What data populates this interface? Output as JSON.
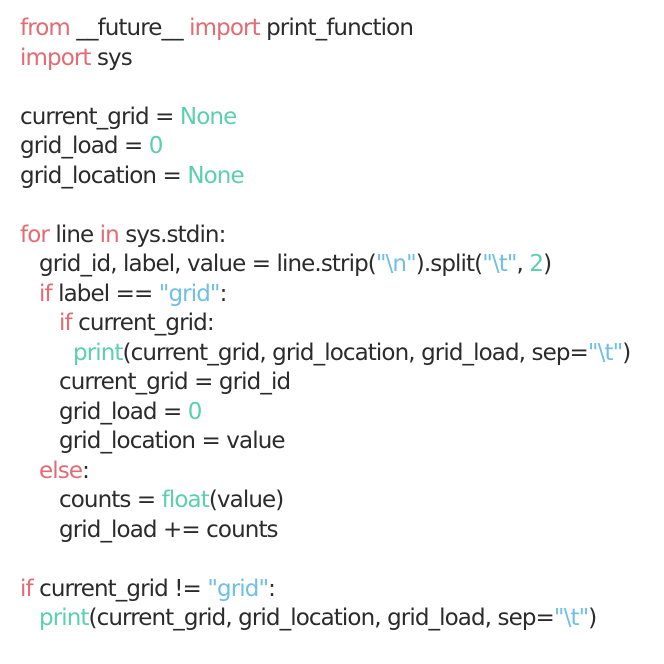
{
  "colors": {
    "keyword": "#e36b74",
    "number_constant": "#5ccfb0",
    "string": "#6fbfe6",
    "builtin": "#5ccfb0",
    "text": "#2b2b2b",
    "background": "#ffffff"
  },
  "code_lines": [
    {
      "indent": 0,
      "tokens": [
        {
          "t": "from",
          "c": "kw"
        },
        {
          "t": " __future__ ",
          "c": "plain"
        },
        {
          "t": "import",
          "c": "kw"
        },
        {
          "t": " print_function",
          "c": "plain"
        }
      ]
    },
    {
      "indent": 0,
      "tokens": [
        {
          "t": "import",
          "c": "kw"
        },
        {
          "t": " sys",
          "c": "plain"
        }
      ]
    },
    {
      "indent": 0,
      "tokens": []
    },
    {
      "indent": 0,
      "tokens": [
        {
          "t": "current_grid = ",
          "c": "plain"
        },
        {
          "t": "None",
          "c": "num"
        }
      ]
    },
    {
      "indent": 0,
      "tokens": [
        {
          "t": "grid_load = ",
          "c": "plain"
        },
        {
          "t": "0",
          "c": "num"
        }
      ]
    },
    {
      "indent": 0,
      "tokens": [
        {
          "t": "grid_location = ",
          "c": "plain"
        },
        {
          "t": "None",
          "c": "num"
        }
      ]
    },
    {
      "indent": 0,
      "tokens": []
    },
    {
      "indent": 0,
      "tokens": [
        {
          "t": "for",
          "c": "kw"
        },
        {
          "t": " line ",
          "c": "plain"
        },
        {
          "t": "in",
          "c": "kw"
        },
        {
          "t": " sys.stdin:",
          "c": "plain"
        }
      ]
    },
    {
      "indent": 1,
      "tokens": [
        {
          "t": "grid_id, label, value = line.strip(",
          "c": "plain"
        },
        {
          "t": "\"\\n\"",
          "c": "str"
        },
        {
          "t": ").split(",
          "c": "plain"
        },
        {
          "t": "\"\\t\"",
          "c": "str"
        },
        {
          "t": ", ",
          "c": "plain"
        },
        {
          "t": "2",
          "c": "num"
        },
        {
          "t": ")",
          "c": "plain"
        }
      ]
    },
    {
      "indent": 1,
      "tokens": [
        {
          "t": "if",
          "c": "kw"
        },
        {
          "t": " label == ",
          "c": "plain"
        },
        {
          "t": "\"grid\"",
          "c": "str"
        },
        {
          "t": ":",
          "c": "plain"
        }
      ]
    },
    {
      "indent": 2,
      "tokens": [
        {
          "t": "if",
          "c": "kw"
        },
        {
          "t": " current_grid:",
          "c": "plain"
        }
      ]
    },
    {
      "indent": 3,
      "tokens": [
        {
          "t": "print",
          "c": "bi"
        },
        {
          "t": "(current_grid, grid_location, grid_load, sep=",
          "c": "plain"
        },
        {
          "t": "\"\\t\"",
          "c": "str"
        },
        {
          "t": ")",
          "c": "plain"
        }
      ]
    },
    {
      "indent": 2,
      "tokens": [
        {
          "t": "current_grid = grid_id",
          "c": "plain"
        }
      ]
    },
    {
      "indent": 2,
      "tokens": [
        {
          "t": "grid_load = ",
          "c": "plain"
        },
        {
          "t": "0",
          "c": "num"
        }
      ]
    },
    {
      "indent": 2,
      "tokens": [
        {
          "t": "grid_location = value",
          "c": "plain"
        }
      ]
    },
    {
      "indent": 1,
      "tokens": [
        {
          "t": "else",
          "c": "kw"
        },
        {
          "t": ":",
          "c": "plain"
        }
      ]
    },
    {
      "indent": 2,
      "tokens": [
        {
          "t": "counts = ",
          "c": "plain"
        },
        {
          "t": "float",
          "c": "bi"
        },
        {
          "t": "(value)",
          "c": "plain"
        }
      ]
    },
    {
      "indent": 2,
      "tokens": [
        {
          "t": "grid_load += counts",
          "c": "plain"
        }
      ]
    },
    {
      "indent": 0,
      "tokens": []
    },
    {
      "indent": 0,
      "tokens": [
        {
          "t": "if",
          "c": "kw"
        },
        {
          "t": " current_grid != ",
          "c": "plain"
        },
        {
          "t": "\"grid\"",
          "c": "str"
        },
        {
          "t": ":",
          "c": "plain"
        }
      ]
    },
    {
      "indent": 1,
      "tokens": [
        {
          "t": "print",
          "c": "bi"
        },
        {
          "t": "(current_grid, grid_location, grid_load, sep=",
          "c": "plain"
        },
        {
          "t": "\"\\t\"",
          "c": "str"
        },
        {
          "t": ")",
          "c": "plain"
        }
      ]
    }
  ]
}
